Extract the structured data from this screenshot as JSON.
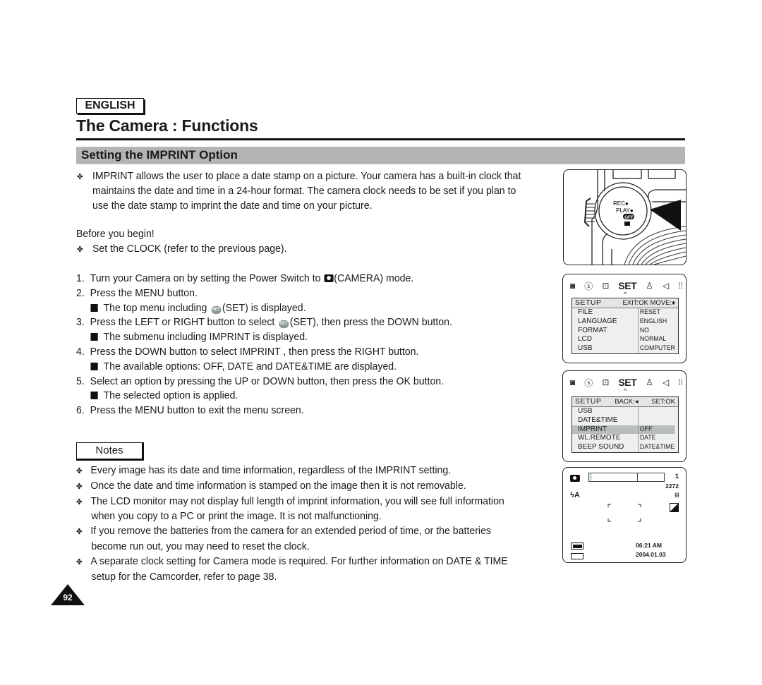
{
  "header": {
    "language_badge": "ENGLISH",
    "page_title": "The Camera : Functions",
    "section_title": "Setting the IMPRINT Option"
  },
  "intro": {
    "bullet_glyph": "✤",
    "lines": [
      "IMPRINT allows the user to place a date stamp on a picture. Your camera has a built-in clock that",
      "maintains the date and time in a 24-hour format. The camera clock needs to be set if you plan to",
      "use the date stamp to imprint the date and time on your picture."
    ],
    "before_label": "Before you begin!",
    "before_item": "Set the CLOCK (refer to the previous page)."
  },
  "steps": [
    {
      "num": "1.",
      "pre": "Turn your Camera on by setting the Power Switch to ",
      "icon": "camera-icon",
      "post": "(CAMERA) mode."
    },
    {
      "num": "2.",
      "text": "Press the MENU button."
    },
    {
      "sub": true,
      "pre": "The top menu including ",
      "icon": "set-icon",
      "post": "(SET) is displayed."
    },
    {
      "num": "3.",
      "pre": "Press the LEFT or RIGHT button to select ",
      "icon": "set-icon",
      "post": "(SET), then press the DOWN button."
    },
    {
      "sub": true,
      "text": "The submenu including  IMPRINT  is displayed."
    },
    {
      "num": "4.",
      "text": "Press the DOWN button to select  IMPRINT , then press the RIGHT button."
    },
    {
      "sub": true,
      "text": "The available options: OFF, DATE and DATE&TIME are displayed."
    },
    {
      "num": "5.",
      "text": "Select an option by pressing the UP or DOWN button, then press the OK button."
    },
    {
      "sub": true,
      "text": "The selected option is applied."
    },
    {
      "num": "6.",
      "text": "Press the MENU button to exit the menu screen."
    }
  ],
  "notes": {
    "label": "Notes",
    "items": [
      [
        "Every image has its date and time information, regardless of the IMPRINT setting."
      ],
      [
        "Once the date and time information is stamped on the image then it is not removable."
      ],
      [
        "The LCD monitor may not display full length of imprint information, you will see full information",
        "when you copy to a PC or print the image. It is not malfunctioning."
      ],
      [
        "If you remove the batteries from the camera for an extended period of time, or the batteries",
        "become run out, you may need to reset the clock."
      ],
      [
        "A separate clock setting for Camera mode is required. For further information on DATE & TIME",
        "setup for the Camcorder, refer to page 38."
      ]
    ]
  },
  "page_number": "92",
  "illustration": {
    "dial_labels": [
      "REC",
      "PLAY",
      "OFF"
    ]
  },
  "lcd_menu_1": {
    "top_icons": [
      "photo-icon",
      "self-timer-icon",
      "frame-icon",
      "SET",
      "person-icon",
      "speaker-icon",
      "grid-icon"
    ],
    "set_label": "SET",
    "header_left": "SETUP",
    "header_right": "EXIT:OK  MOVE:♦",
    "left_items": [
      "FILE",
      "LANGUAGE",
      "FORMAT",
      "LCD",
      "USB"
    ],
    "right_items": [
      "RESET",
      "ENGLISH",
      "NO",
      "NORMAL",
      "COMPUTER"
    ]
  },
  "lcd_menu_2": {
    "set_label": "SET",
    "header_left": "SETUP",
    "header_mid": "BACK:◂",
    "header_right": "SET:OK",
    "left_items": [
      "USB",
      "DATE&TIME",
      "IMPRINT",
      "WL.REMOTE",
      "BEEP SOUND"
    ],
    "right_items": [
      "",
      "",
      "OFF",
      "DATE",
      "DATE&TIME"
    ],
    "highlighted_index": 2
  },
  "lcd_preview": {
    "shots_remaining": "1",
    "resolution": "2272",
    "flash": "ϟA",
    "time": "06:21 AM",
    "date": "2004.01.03",
    "zoom_bar_fill": 0.04
  }
}
